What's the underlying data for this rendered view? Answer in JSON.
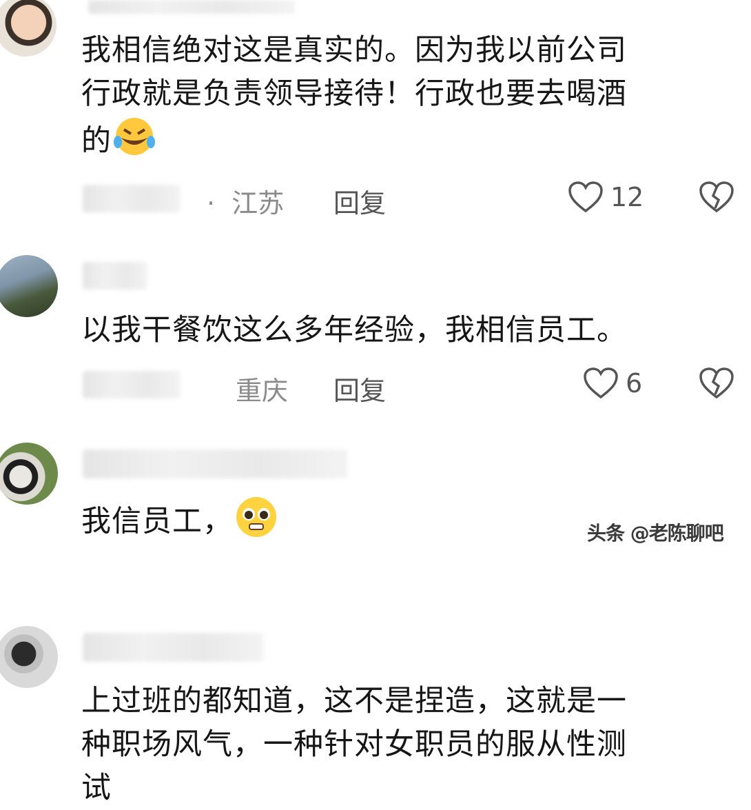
{
  "comments": [
    {
      "text_lines": [
        "我相信绝对这是真实的。因为我以前公司",
        "行政就是负责领导接待！行政也要去喝酒",
        "的"
      ],
      "emoji": "rofl-emoji",
      "location": "江苏",
      "reply_label": "回复",
      "likes": "12"
    },
    {
      "text_lines": [
        "以我干餐饮这么多年经验，我相信员工。"
      ],
      "location": "重庆",
      "reply_label": "回复",
      "likes": "6"
    },
    {
      "text_lines": [
        "我信员工，"
      ],
      "emoji": "pleading-face-emoji"
    },
    {
      "text_lines": [
        "上过班的都知道，这不是捏造，这就是一",
        "种职场风气，一种针对女职员的服从性测",
        "试"
      ]
    }
  ],
  "watermark": "头条 @老陈聊吧",
  "separator": "·",
  "icons": {
    "like": "heart-outline-icon",
    "dislike": "broken-heart-icon"
  },
  "colors": {
    "meta_gray": "#8a8a8a",
    "text": "#161616"
  }
}
